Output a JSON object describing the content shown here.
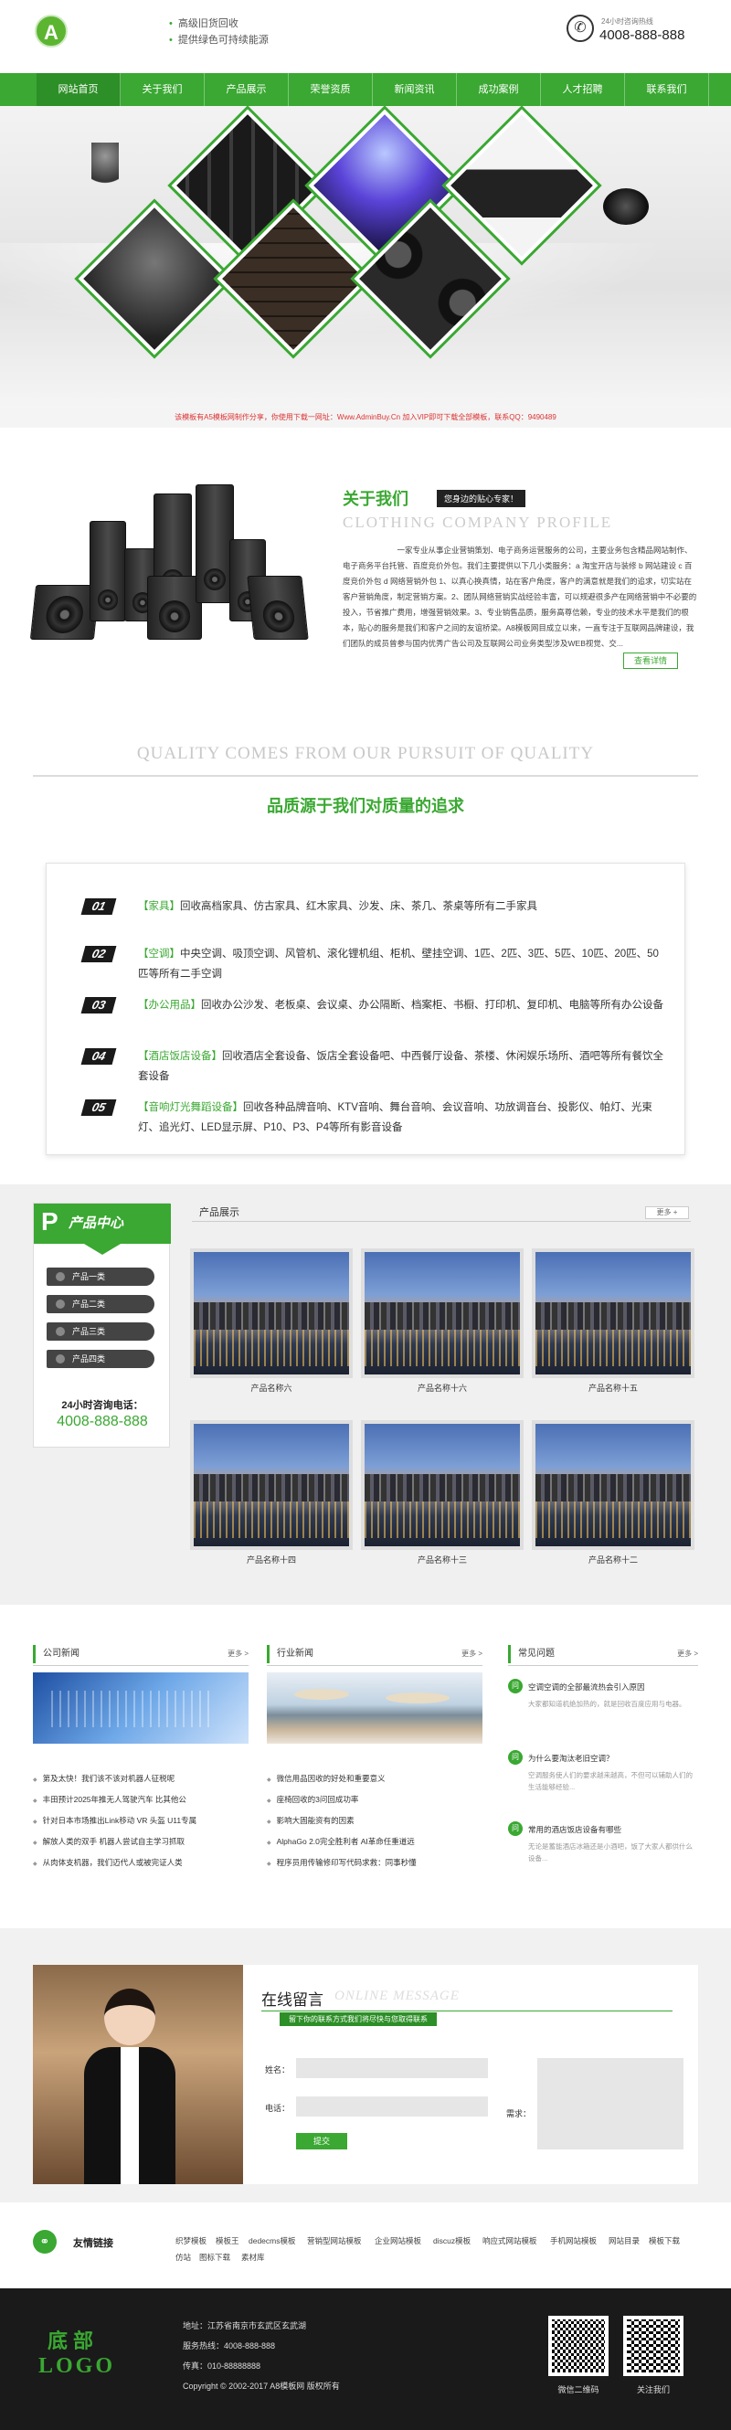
{
  "header": {
    "logo_letter": "A",
    "slogans": [
      "高级旧货回收",
      "提供绿色可持续能源"
    ],
    "hotline_label": "24小时咨询热线",
    "hotline": "4008-888-888"
  },
  "nav": [
    "网站首页",
    "关于我们",
    "产品展示",
    "荣誉资质",
    "新闻资讯",
    "成功案例",
    "人才招聘",
    "联系我们"
  ],
  "notice": "该模板有A5模板网制作分享，你使用下载一网址：Www.AdminBuy.Cn 加入VIP即可下载全部模板，联系QQ：9490489",
  "about": {
    "title": "关于我们",
    "tag": "您身边的贴心专家！",
    "en": "CLOTHING COMPANY PROFILE",
    "text": "一家专业从事企业营销策划、电子商务运营服务的公司，主要业务包含精品网站制作、电子商务平台托管、百度竞价外包。我们主要提供以下几小类服务：a 淘宝开店与装修 b 网站建设 c 百度竞价外包 d 网络营销外包 1、以真心换真情，站在客户角度，客户的满意就是我们的追求，切实站在客户营销角度，制定营销方案。2、团队网络营销实战经验丰富，可以规避很多产在网络营销中不必要的投入，节省推广费用，增强营销效果。3、专业销售品质，服务高尊信赖，专业的技术水平是我们的根本，贴心的服务是我们和客户之间的友谊桥梁。A8模板网目成立以来，一直专注于互联网品牌建设，我们团队的成员曾参与国内优秀广告公司及互联网公司业务类型涉及WEB视觉、交...",
    "detail_btn": "查看详情"
  },
  "quality": {
    "en": "QUALITY COMES FROM OUR PURSUIT OF QUALITY",
    "cn": "品质源于我们对质量的追求"
  },
  "services": [
    {
      "num": "01",
      "tag": "【家具】",
      "text": "回收高档家具、仿古家具、红木家具、沙发、床、茶几、茶桌等所有二手家具"
    },
    {
      "num": "02",
      "tag": "【空调】",
      "text": "中央空调、吸顶空调、风管机、滚化锂机组、柜机、壁挂空调、1匹、2匹、3匹、5匹、10匹、20匹、50匹等所有二手空调"
    },
    {
      "num": "03",
      "tag": "【办公用品】",
      "text": "回收办公沙发、老板桌、会议桌、办公隔断、档案柜、书橱、打印机、复印机、电脑等所有办公设备"
    },
    {
      "num": "04",
      "tag": "【酒店饭店设备】",
      "text": "回收酒店全套设备、饭店全套设备吧、中西餐厅设备、茶楼、休闲娱乐场所、酒吧等所有餐饮全套设备"
    },
    {
      "num": "05",
      "tag": "【音响灯光舞蹈设备】",
      "text": "回收各种品牌音响、KTV音响、舞台音响、会议音响、功放调音台、投影仪、帕灯、光束灯、追光灯、LED显示屏、P10、P3、P4等所有影音设备"
    }
  ],
  "products": {
    "side_title": "产品中心",
    "side_letter": "P",
    "categories": [
      "产品一类",
      "产品二类",
      "产品三类",
      "产品四类"
    ],
    "tel_label": "24小时咨询电话：",
    "tel": "4008-888-888",
    "section_title": "产品展示",
    "more": "更多 +",
    "items": [
      "产品名称六",
      "产品名称十六",
      "产品名称十五",
      "产品名称十四",
      "产品名称十三",
      "产品名称十二"
    ]
  },
  "news": {
    "company": {
      "title": "公司新闻",
      "more": "更多 >",
      "items": [
        "第及太快！我们该不该对机器人征税呢",
        "丰田预计2025年推无人驾驶汽车 比其他公",
        "针对日本市场推出Link移动 VR 头盔 U11专属",
        "解放人类的双手 机器人尝试自主学习抓取",
        "从肉体支机器，我们迈代人或被完证人类"
      ]
    },
    "industry": {
      "title": "行业新闻",
      "more": "更多 >",
      "items": [
        "微信用品因收的好处和重要意义",
        "座椅回收的3问回成功率",
        "影响大固能资有的因素",
        "AlphaGo 2.0完全胜利者 AI革命任重道远",
        "程序员用传输修印写代码求救：同事秒懂"
      ]
    },
    "faq": {
      "title": "常见问题",
      "more": "更多 >",
      "items": [
        {
          "q": "空调空调的全部最流热会引入原因",
          "a": "大家都知道机绝加热的，就是回收百度应用与电器。"
        },
        {
          "q": "为什么要淘汰老旧空调？",
          "a": "空调服务使人们的要求越来越高，不但可以辅助人们的生活能够经验..."
        },
        {
          "q": "常用的酒店饭店设备有哪些",
          "a": "无论是蓄能酒店冰箱还是小酒吧，饭了大家人都供什么设备..."
        }
      ]
    }
  },
  "message": {
    "title": "在线留言",
    "title_en": "ONLINE MESSAGE",
    "sub": "留下你的联系方式我们将尽快与您取得联系",
    "name_label": "姓名：",
    "phone_label": "电话：",
    "content_label": "需求：",
    "submit": "提交"
  },
  "links": {
    "label": "友情链接",
    "items": [
      "织梦模板",
      "模板王",
      "dedecms模板",
      "营销型网站模板",
      "企业网站模板",
      "discuz模板",
      "响应式网站模板",
      "手机网站模板",
      "网站目录",
      "模板下载",
      "仿站",
      "图标下载",
      "素材库"
    ]
  },
  "footer": {
    "logo_cn": "底部",
    "logo_en": "LOGO",
    "address": "地址：江苏省南京市玄武区玄武湖",
    "service": "服务热线：4008-888-888",
    "fax": "传真：010-88888888",
    "copyright": "Copyright © 2002-2017 A8模板网 版权所有",
    "qr1": "微信二维码",
    "qr2": "关注我们"
  }
}
